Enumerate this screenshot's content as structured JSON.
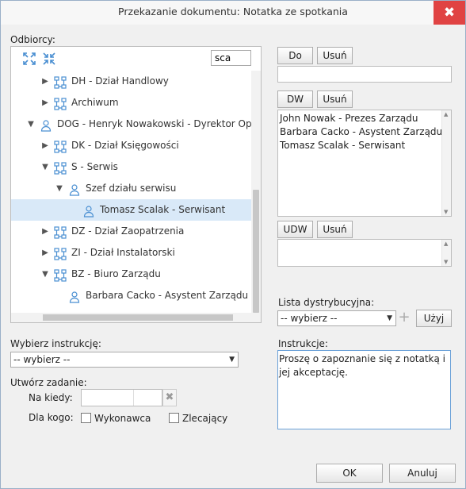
{
  "dialog": {
    "title": "Przekazanie dokumentu: Notatka ze spotkania",
    "close_glyph": "✖"
  },
  "recipients": {
    "label": "Odbiorcy:",
    "search_value": "sca",
    "icons": [
      "expand-all-icon",
      "collapse-all-icon"
    ],
    "tree": [
      {
        "text": "DH - Dział Handlowy",
        "type": "org",
        "level": 2,
        "expander": "right"
      },
      {
        "text": "Archiwum",
        "type": "org",
        "level": 2,
        "expander": "right"
      },
      {
        "text": "DOG - Henryk Nowakowski - Dyrektor Operac",
        "type": "user",
        "level": 1,
        "expander": "down"
      },
      {
        "text": "DK - Dział Księgowości",
        "type": "org",
        "level": 2,
        "expander": "right"
      },
      {
        "text": "S - Serwis",
        "type": "org",
        "level": 2,
        "expander": "down"
      },
      {
        "text": "Szef działu serwisu",
        "type": "user",
        "level": 3,
        "expander": "down"
      },
      {
        "text": "Tomasz Scalak - Serwisant",
        "type": "user",
        "level": 4,
        "expander": "",
        "selected": true
      },
      {
        "text": "DZ - Dział Zaopatrzenia",
        "type": "org",
        "level": 2,
        "expander": "right"
      },
      {
        "text": "ZI - Dział Instalatorski",
        "type": "org",
        "level": 2,
        "expander": "right"
      },
      {
        "text": "BZ - Biuro Zarządu",
        "type": "org",
        "level": 2,
        "expander": "down"
      },
      {
        "text": "Barbara Cacko - Asystent Zarządu",
        "type": "user",
        "level": 3,
        "expander": ""
      }
    ]
  },
  "do_section": {
    "add_label": "Do",
    "remove_label": "Usuń",
    "values": []
  },
  "dw_section": {
    "add_label": "DW",
    "remove_label": "Usuń",
    "values": [
      "John Nowak - Prezes Zarządu",
      "Barbara Cacko - Asystent Zarządu",
      "Tomasz Scalak - Serwisant"
    ]
  },
  "udw_section": {
    "add_label": "UDW",
    "remove_label": "Usuń",
    "values": []
  },
  "distribution": {
    "label": "Lista dystrybucyjna:",
    "selected": "-- wybierz --",
    "add_glyph": "+",
    "use_label": "Użyj"
  },
  "instruction_select": {
    "label": "Wybierz instrukcję:",
    "selected": "-- wybierz --"
  },
  "instructions": {
    "label": "Instrukcje:",
    "text": "Proszę o zapoznanie się z notatką i jej akceptację."
  },
  "task": {
    "label": "Utwórz zadanie:",
    "when_label": "Na kiedy:",
    "when_value": "",
    "for_whom_label": "Dla kogo:",
    "options": [
      {
        "label": "Wykonawca",
        "checked": false
      },
      {
        "label": "Zlecający",
        "checked": false
      }
    ]
  },
  "footer": {
    "ok_label": "OK",
    "cancel_label": "Anuluj"
  },
  "colors": {
    "accent": "#4a8fd2",
    "selected_row": "#d9e9f8",
    "close": "#e04343"
  }
}
